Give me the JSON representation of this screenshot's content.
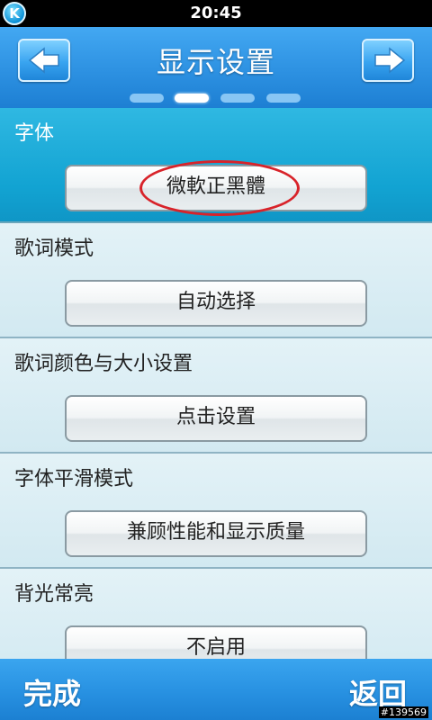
{
  "status_bar": {
    "time": "20:45",
    "app_badge": "K"
  },
  "header": {
    "title": "显示设置",
    "prev_icon": "arrow-left-icon",
    "next_icon": "arrow-right-icon",
    "pages_total": 4,
    "page_current": 2
  },
  "sections": [
    {
      "label": "字体",
      "value": "微軟正黑體",
      "selected": true,
      "annotated": true
    },
    {
      "label": "歌词模式",
      "value": "自动选择"
    },
    {
      "label": "歌词颜色与大小设置",
      "value": "点击设置"
    },
    {
      "label": "字体平滑模式",
      "value": "兼顾性能和显示质量"
    },
    {
      "label": "背光常亮",
      "value": "不启用"
    }
  ],
  "footer": {
    "done": "完成",
    "back": "返回"
  },
  "watermark": "#139569",
  "colors": {
    "accent": "#2b8fe0",
    "selected_row": "#12a3d2",
    "annotation": "#d8232a"
  }
}
